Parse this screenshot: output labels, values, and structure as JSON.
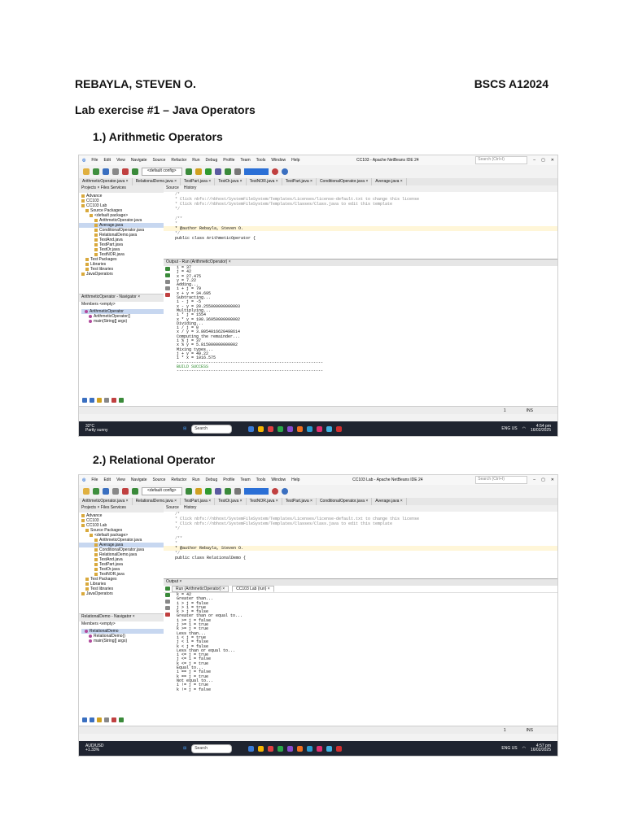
{
  "header": {
    "student": "REBAYLA, STEVEN O.",
    "course": "BSCS A12024",
    "title": "Lab exercise #1 – Java Operators"
  },
  "sections": [
    {
      "heading": "1.) Arithmetic Operators",
      "screenshot": {
        "window_title": "CC103 - Apache NetBeans IDE 24",
        "menu": [
          "File",
          "Edit",
          "View",
          "Navigate",
          "Source",
          "Refactor",
          "Run",
          "Debug",
          "Profile",
          "Team",
          "Tools",
          "Window",
          "Help"
        ],
        "search_placeholder": "Search (Ctrl+I)",
        "config": "<default config>",
        "tabs": [
          "ArithmeticOperator.java ×",
          "RelationalDemo.java ×",
          "TestPart.java ×",
          "TestOr.java ×",
          "TestNOR.java ×",
          "TestPart.java ×",
          "ConditionalOperator.java ×",
          "Average.java ×"
        ],
        "project_tabs": "Projects ×   Files   Services",
        "tree": [
          "Advance",
          "CC103",
          "CC103 Lab",
          "Source Packages",
          "<default package>",
          "ArithmeticOperator.java",
          "Average.java",
          "ConditionalOperator.java",
          "RelationalDemo.java",
          "TestAnd.java",
          "TestPart.java",
          "TestOr.java",
          "TestNOR.java",
          "Test Packages",
          "Libraries",
          "Test libraries",
          "JavaOperators"
        ],
        "navigator_title": "ArithmeticOperator - Navigator ×",
        "navigator_bar": "Members   <empty>",
        "navigator": [
          "ArithmeticOperator",
          "ArithmeticOperator()",
          "main(String[] args)"
        ],
        "editor_tabs": [
          "Source",
          "History"
        ],
        "code": [
          "/*",
          " * Click nbfs://nbhost/SystemFileSystem/Templates/Licenses/license-default.txt to change this license",
          " * Click nbfs://nbhost/SystemFileSystem/Templates/Classes/Class.java to edit this template",
          " */",
          "",
          "/**",
          " *",
          " * @author Rebayla, Steven O.",
          " */",
          "public class ArithmeticOperator {"
        ],
        "output_title": "Output - Run (ArithmeticOperator) ×",
        "output_tabs": [],
        "output": [
          "i = 37",
          "j = 42",
          "x = 27.475",
          "y = 7.22",
          "Adding...",
          "i + j = 79",
          "x + y = 34.695",
          "Subtracting...",
          "i - j = -5",
          "x - y = 20.255000000000003",
          "Multiplying...",
          "i * j = 1554",
          "x * y = 198.36950000000002",
          "Dividing...",
          "i / j = 0",
          "x / y = 3.8054016620498614",
          "Computing the remainder...",
          "i % j = 37",
          "x % y = 5.815000000000002",
          "Mixing types...",
          "j + y = 49.22",
          "i * x = 1016.575",
          "------------------------------------------------------------",
          "BUILD SUCCESS",
          "------------------------------------------------------------"
        ],
        "status": [
          "1",
          "INS"
        ],
        "weather_temp": "32°C",
        "weather_desc": "Partly sunny",
        "taskbar_search": "Search",
        "tray": "ENG US",
        "time": "4:54 pm",
        "date": "16/02/2025"
      }
    },
    {
      "heading": "2.) Relational Operator",
      "screenshot": {
        "window_title": "CC103 Lab - Apache NetBeans IDE 24",
        "menu": [
          "File",
          "Edit",
          "View",
          "Navigate",
          "Source",
          "Refactor",
          "Run",
          "Debug",
          "Profile",
          "Team",
          "Tools",
          "Window",
          "Help"
        ],
        "search_placeholder": "Search (Ctrl+I)",
        "config": "<default config>",
        "tabs": [
          "ArithmeticOperator.java ×",
          "RelationalDemo.java ×",
          "TestPart.java ×",
          "TestOr.java ×",
          "TestNOR.java ×",
          "TestPart.java ×",
          "ConditionalOperator.java ×",
          "Average.java ×"
        ],
        "project_tabs": "Projects ×   Files   Services",
        "tree": [
          "Advance",
          "CC103",
          "CC103 Lab",
          "Source Packages",
          "<default package>",
          "ArithmeticOperator.java",
          "Average.java",
          "ConditionalOperator.java",
          "RelationalDemo.java",
          "TestAnd.java",
          "TestPart.java",
          "TestOr.java",
          "TestNOR.java",
          "Test Packages",
          "Libraries",
          "Test libraries",
          "JavaOperators"
        ],
        "navigator_title": "RelationalDemo - Navigator ×",
        "navigator_bar": "Members   <empty>",
        "navigator": [
          "RelationalDemo",
          "RelationalDemo()",
          "main(String[] args)"
        ],
        "editor_tabs": [
          "Source",
          "History"
        ],
        "code": [
          "/*",
          " * Click nbfs://nbhost/SystemFileSystem/Templates/Licenses/license-default.txt to change this license",
          " * Click nbfs://nbhost/SystemFileSystem/Templates/Classes/Class.java to edit this template",
          " */",
          "",
          "/**",
          " *",
          " * @author Rebayla, Steven O.",
          " */",
          "public class RelationalDemo {"
        ],
        "output_title": "Output ×",
        "output_tabs": [
          "Run (ArithmeticOperator) ×",
          "CC103 Lab (run) ×"
        ],
        "output": [
          "k = 42",
          "Greater than...",
          "i > j = false",
          "j > i = true",
          "k > j = false",
          "Greater than or equal to...",
          "i >= j = false",
          "j >= i = true",
          "k >= j = true",
          "Less than...",
          "i < j = true",
          "j < i = false",
          "k < j = false",
          "Less than or equal to...",
          "i <= j = true",
          "j <= i = false",
          "k <= j = true",
          "Equal to...",
          "i == j = false",
          "k == j = true",
          "Not equal to...",
          "i != j = true",
          "k != j = false"
        ],
        "status": [
          "1",
          "INS"
        ],
        "weather_temp": "AUD/USD",
        "weather_desc": "+1.33%",
        "taskbar_search": "Search",
        "tray": "ENG US",
        "time": "4:57 pm",
        "date": "16/02/2025"
      }
    }
  ],
  "colors": {
    "accent": "#2a6fd6",
    "taskbar": "#1f2430",
    "highlight": "#fff6d8"
  }
}
